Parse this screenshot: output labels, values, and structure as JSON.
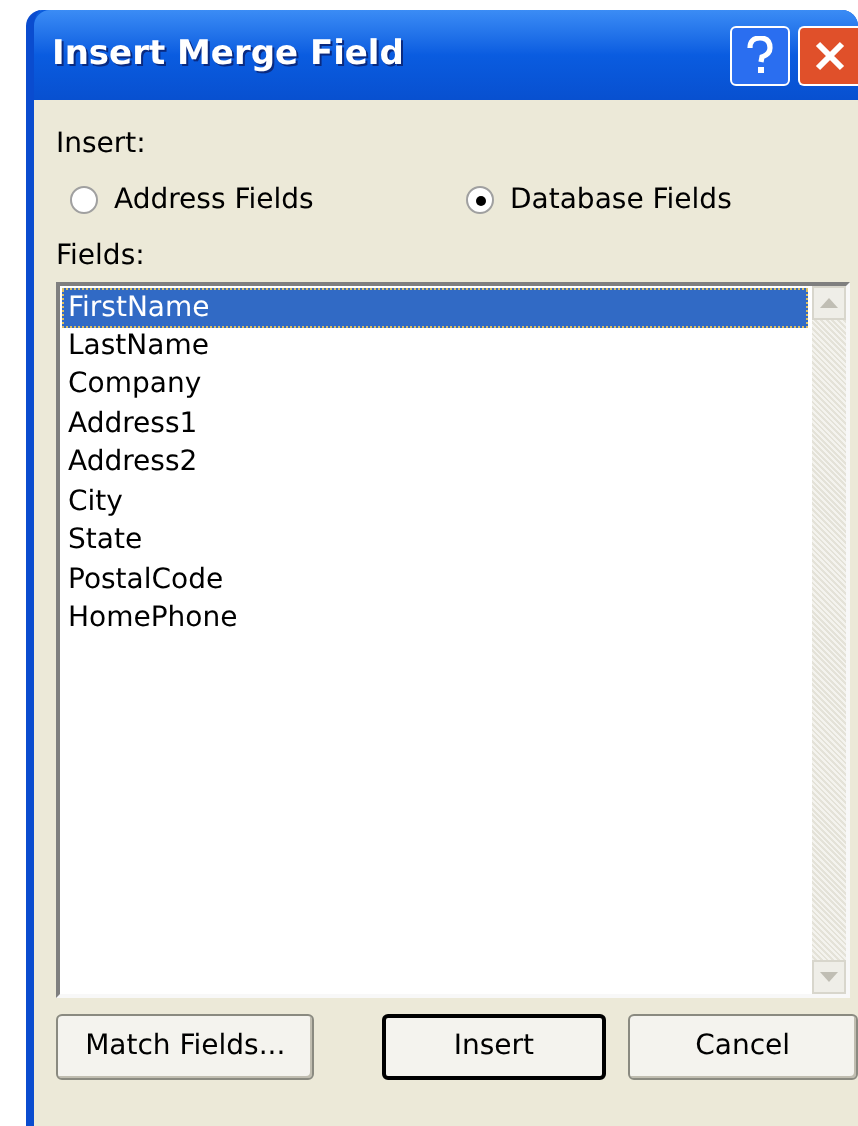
{
  "window": {
    "title": "Insert Merge Field"
  },
  "insert_label": "Insert:",
  "insert_options": [
    {
      "label": "Address Fields",
      "selected": false
    },
    {
      "label": "Database Fields",
      "selected": true
    }
  ],
  "fields_label": "Fields:",
  "fields": [
    {
      "label": "FirstName",
      "selected": true
    },
    {
      "label": "LastName",
      "selected": false
    },
    {
      "label": "Company",
      "selected": false
    },
    {
      "label": "Address1",
      "selected": false
    },
    {
      "label": "Address2",
      "selected": false
    },
    {
      "label": "City",
      "selected": false
    },
    {
      "label": "State",
      "selected": false
    },
    {
      "label": "PostalCode",
      "selected": false
    },
    {
      "label": "HomePhone",
      "selected": false
    }
  ],
  "buttons": [
    {
      "label": "Match Fields...",
      "kind": "normal"
    },
    {
      "label": "Insert",
      "kind": "default"
    },
    {
      "label": "Cancel",
      "kind": "normal"
    }
  ]
}
